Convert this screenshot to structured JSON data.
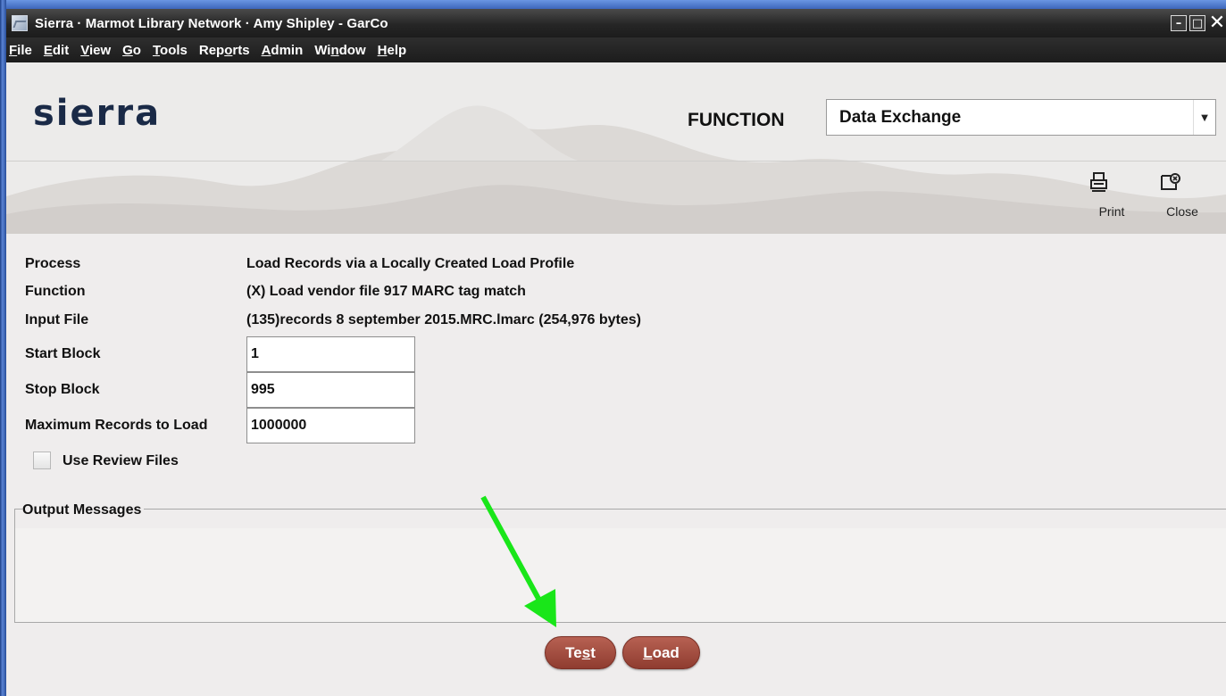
{
  "window": {
    "title": "Sierra · Marmot Library Network · Amy Shipley - GarCo",
    "controls": [
      "minimize",
      "maximize",
      "close"
    ]
  },
  "menu": [
    {
      "pre": "",
      "mn": "F",
      "post": "ile"
    },
    {
      "pre": "",
      "mn": "E",
      "post": "dit"
    },
    {
      "pre": "",
      "mn": "V",
      "post": "iew"
    },
    {
      "pre": "",
      "mn": "G",
      "post": "o"
    },
    {
      "pre": "",
      "mn": "T",
      "post": "ools"
    },
    {
      "pre": "Rep",
      "mn": "o",
      "post": "rts"
    },
    {
      "pre": "",
      "mn": "A",
      "post": "dmin"
    },
    {
      "pre": "Wi",
      "mn": "n",
      "post": "dow"
    },
    {
      "pre": "",
      "mn": "H",
      "post": "elp"
    }
  ],
  "header": {
    "logo": "sierra",
    "function_label": "FUNCTION",
    "function_value": "Data Exchange"
  },
  "toolbar": {
    "print_label": "Print",
    "close_label": "Close"
  },
  "form": {
    "process_label": "Process",
    "process_value": "Load Records via a Locally Created Load Profile",
    "function_label": "Function",
    "function_value": "(X)  Load vendor file 917 MARC tag match",
    "input_file_label": "Input File",
    "input_file_value": "(135)records 8 september 2015.MRC.lmarc  (254,976 bytes)",
    "start_block_label": "Start Block",
    "start_block_value": "1",
    "stop_block_label": "Stop Block",
    "stop_block_value": "995",
    "max_records_label": "Maximum Records to Load",
    "max_records_value": "1000000",
    "review_files_label": "Use Review Files",
    "review_files_checked": false
  },
  "output": {
    "title": "Output Messages",
    "messages": ""
  },
  "buttons": {
    "test": {
      "pre": "Te",
      "mn": "s",
      "post": "t"
    },
    "load": {
      "pre": "",
      "mn": "L",
      "post": "oad"
    }
  },
  "annotation": {
    "arrow_color": "#19e619"
  },
  "colors": {
    "accent_button": "#a04a3d",
    "titlebar": "#262626",
    "logo": "#1a2a47"
  }
}
